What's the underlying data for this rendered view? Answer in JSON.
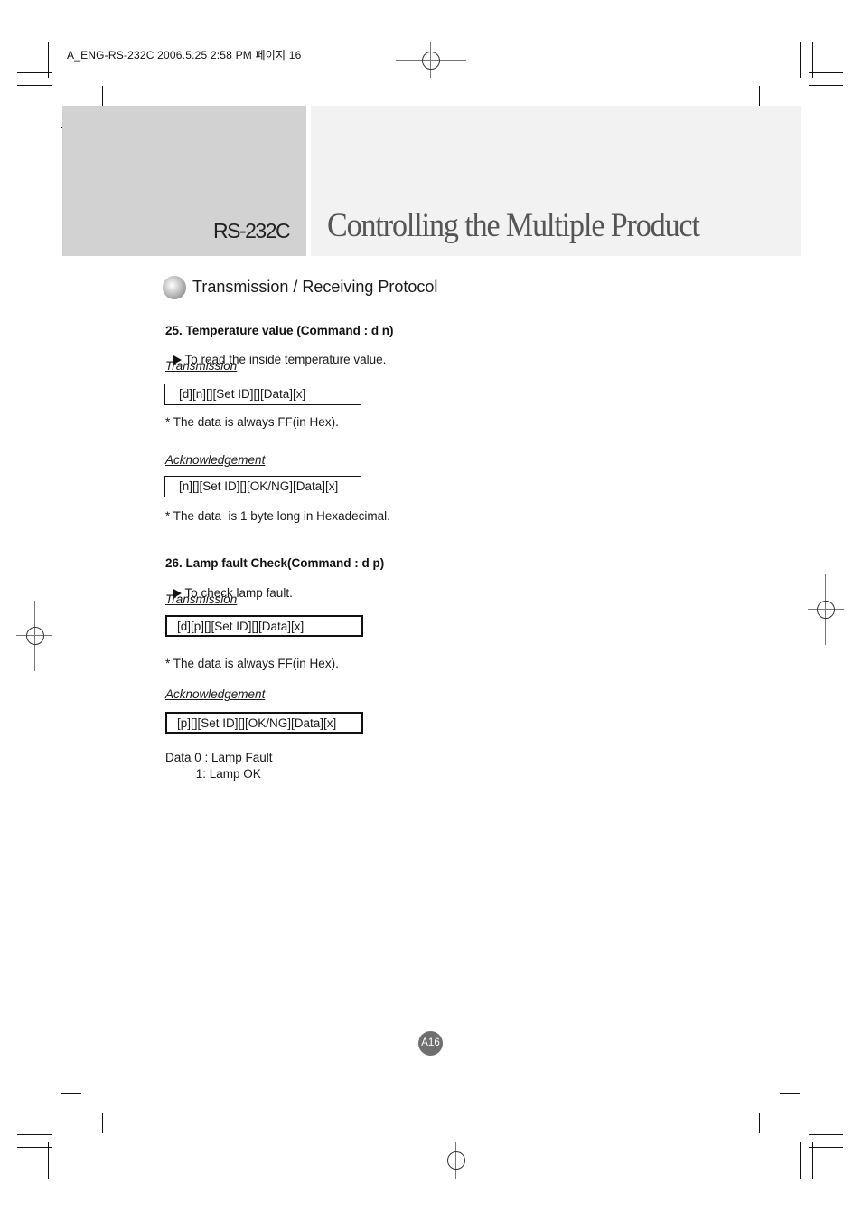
{
  "slug": "A_ENG-RS-232C  2006.5.25  2:58 PM 페이지 16",
  "header": {
    "section_label": "RS-232C",
    "title": "Controlling the Multiple Product",
    "colors": {
      "left_panel": "#d2d2d2",
      "right_panel": "#f2f2f2",
      "title_text": "#555555"
    }
  },
  "section": {
    "icon": "gray-sphere-bullet-icon",
    "heading": "Transmission / Receiving Protocol"
  },
  "items": [
    {
      "title": "25. Temperature value (Command : d n)",
      "description": "To read the inside temperature value.",
      "transmission_label": "Transmission",
      "transmission_code": "[d][n][][Set ID][][Data][x]",
      "transmission_note": "* The data is always FF(in Hex).",
      "ack_label": "Acknowledgement",
      "ack_code": "[n][][Set ID][][OK/NG][Data][x]",
      "ack_note": "* The data  is 1 byte long in Hexadecimal."
    },
    {
      "title": "26. Lamp fault Check(Command : d p)",
      "description": "To check lamp fault.",
      "transmission_label": "Transmission",
      "transmission_code": "[d][p][][Set ID][][Data][x]",
      "transmission_note": "* The data is always FF(in Hex).",
      "ack_label": "Acknowledgement",
      "ack_code": "[p][][Set ID][][OK/NG][Data][x]",
      "data_values": [
        "Data 0 : Lamp Fault",
        "         1: Lamp OK"
      ]
    }
  ],
  "footer": {
    "page_number": "A16",
    "badge_color": "#6f6f6f"
  }
}
